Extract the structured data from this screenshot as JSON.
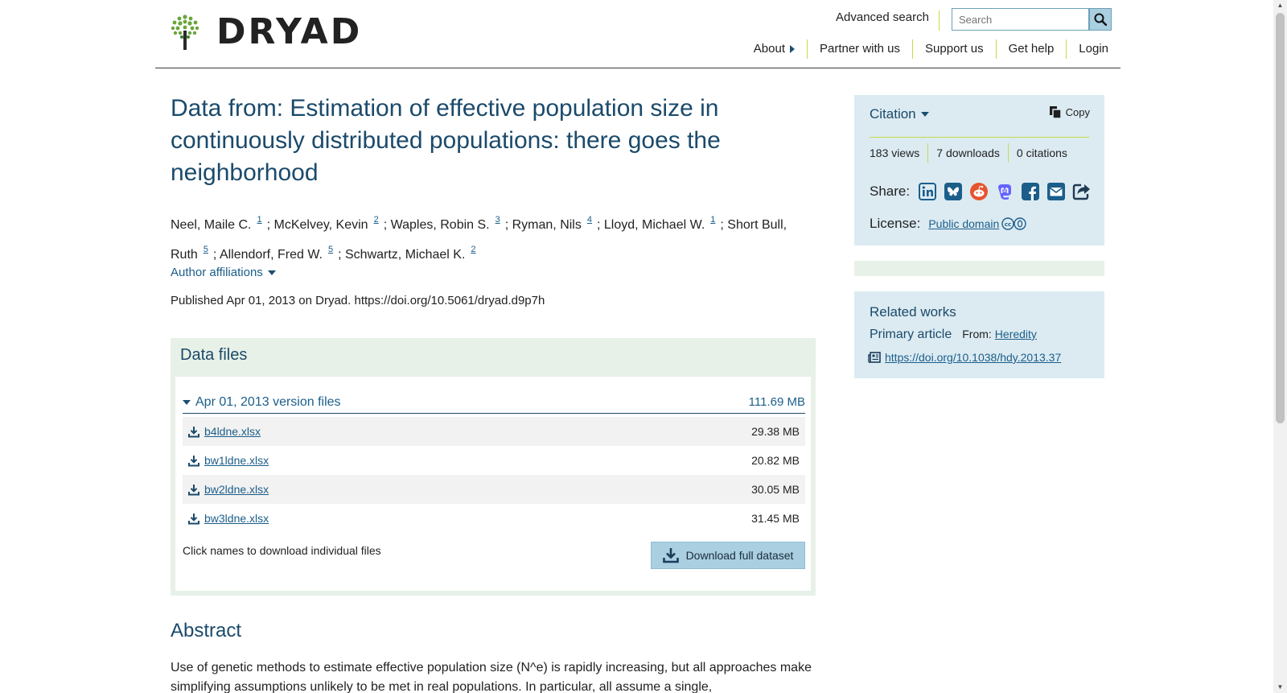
{
  "header": {
    "logo_text": "DRYAD",
    "advanced_search": "Advanced search",
    "search_placeholder": "Search",
    "nav": [
      {
        "label": "About"
      },
      {
        "label": "Partner with us"
      },
      {
        "label": "Support us"
      },
      {
        "label": "Get help"
      },
      {
        "label": "Login"
      }
    ]
  },
  "dataset": {
    "title": "Data from: Estimation of effective population size in continuously distributed populations: there goes the neighborhood",
    "authors": [
      {
        "name": "Neel, Maile C.",
        "aff": "1"
      },
      {
        "name": "McKelvey, Kevin",
        "aff": "2"
      },
      {
        "name": "Waples, Robin S.",
        "aff": "3"
      },
      {
        "name": "Ryman, Nils",
        "aff": "4"
      },
      {
        "name": "Lloyd, Michael W.",
        "aff": "1"
      },
      {
        "name": "Short Bull, Ruth",
        "aff": "5"
      },
      {
        "name": "Allendorf, Fred W.",
        "aff": "5"
      },
      {
        "name": "Schwartz, Michael K.",
        "aff": "2"
      }
    ],
    "author_affiliations": "Author affiliations",
    "published": "Published Apr 01, 2013 on Dryad. https://doi.org/10.5061/dryad.d9p7h"
  },
  "files": {
    "heading": "Data files",
    "version_label": "Apr 01, 2013 version files",
    "version_size": "111.69 MB",
    "items": [
      {
        "name": "b4ldne.xlsx",
        "size": "29.38 MB"
      },
      {
        "name": "bw1ldne.xlsx",
        "size": "20.82 MB"
      },
      {
        "name": "bw2ldne.xlsx",
        "size": "30.05 MB"
      },
      {
        "name": "bw3ldne.xlsx",
        "size": "31.45 MB"
      }
    ],
    "note": "Click names to download individual files",
    "download_label": "Download full dataset"
  },
  "abstract": {
    "heading": "Abstract",
    "text": "Use of genetic methods to estimate effective population size (N^e) is rapidly increasing, but all approaches make simplifying assumptions unlikely to be met in real populations. In particular, all assume a single,"
  },
  "citation": {
    "label": "Citation",
    "copy": "Copy",
    "views": "183 views",
    "downloads": "7 downloads",
    "citations": "0 citations",
    "share_label": "Share:",
    "share_icons": [
      "linkedin-icon",
      "bluesky-icon",
      "reddit-icon",
      "mastodon-icon",
      "facebook-icon",
      "email-icon",
      "share-icon"
    ],
    "license_label": "License:",
    "license_link": "Public domain"
  },
  "related": {
    "heading": "Related works",
    "primary_label": "Primary article",
    "from_label": "From:",
    "from_link": "Heredity",
    "doi": "https://doi.org/10.1038/hdy.2013.37"
  },
  "colors": {
    "accent": "#1b4a6b",
    "link": "#1b5e8a",
    "separator": "#c8d94a",
    "panel_blue": "#dcebf2",
    "panel_green": "#e8f1e7",
    "button": "#a9cfe0"
  }
}
